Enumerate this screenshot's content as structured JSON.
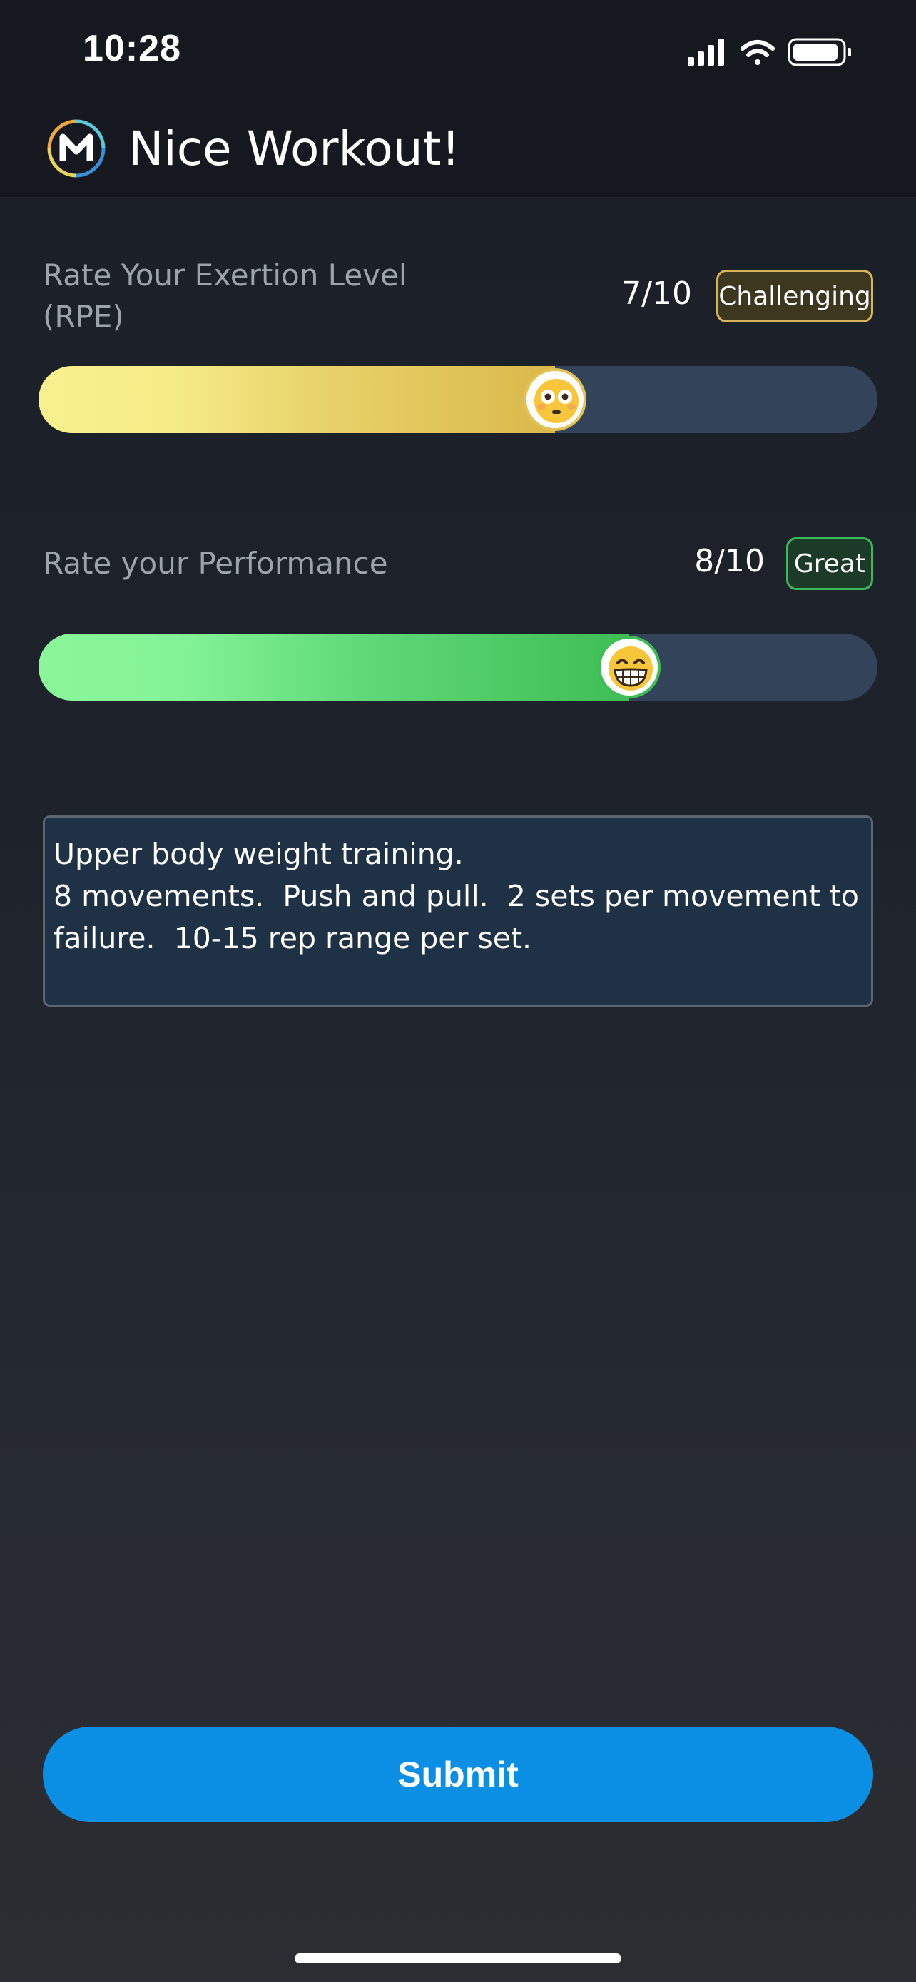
{
  "status_bar": {
    "time": "10:28",
    "icons": [
      "signal-icon",
      "wifi-icon",
      "battery-icon"
    ]
  },
  "header": {
    "title": "Nice Workout!",
    "logo_icon": "app-logo-m-icon"
  },
  "exertion": {
    "label": "Rate Your Exertion Level (RPE)",
    "score": "7/10",
    "badge": "Challenging",
    "level": 0.7,
    "thumb_icon": "flushed-face-emoji-icon",
    "colors": {
      "fill_start": "#f8f08e",
      "fill_end": "#d9b84a",
      "badge_border": "#d8b45a"
    }
  },
  "performance": {
    "label": "Rate your Performance",
    "score": "8/10",
    "badge": "Great",
    "level": 0.8,
    "thumb_icon": "grinning-face-emoji-icon",
    "colors": {
      "fill_start": "#8bf69a",
      "fill_end": "#3fbd55",
      "badge_border": "#3bb95a"
    }
  },
  "notes": {
    "value": "Upper body weight training.\n8 movements.  Push and pull.  2 sets per movement to failure.  10-15 rep range per set."
  },
  "submit": {
    "label": "Submit",
    "color": "#0b8fe5"
  }
}
